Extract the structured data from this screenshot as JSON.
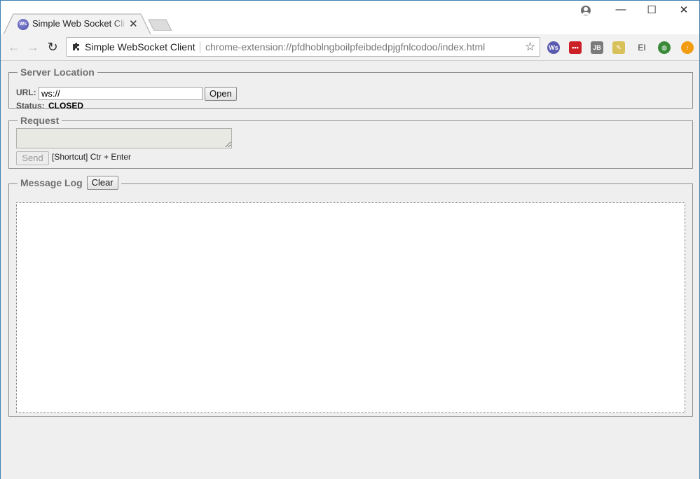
{
  "browser": {
    "tab": {
      "title": "Simple Web Socket Client",
      "favicon_text": "Ws"
    },
    "window_controls": {
      "minimize": "—",
      "maximize": "☐",
      "close": "✕"
    },
    "omnibox": {
      "page_title": "Simple WebSocket Client",
      "url": "chrome-extension://pfdhoblngboilpfeibdedpjgfnlcodoo/index.html"
    },
    "extensions": [
      {
        "name": "ws-extension-icon",
        "label": "Ws",
        "color": "#5a5ab0"
      },
      {
        "name": "lastpass-extension-icon",
        "label": "•••",
        "color": "#cc2027"
      },
      {
        "name": "jetbrains-extension-icon",
        "label": "JB",
        "color": "#7a7a7a"
      },
      {
        "name": "notes-extension-icon",
        "label": "✎",
        "color": "#d9c15a"
      },
      {
        "name": "text-cursor-extension-icon",
        "label": "EI",
        "color": "#333333"
      },
      {
        "name": "globe-extension-icon",
        "label": "◍",
        "color": "#3a8a3a"
      },
      {
        "name": "orange-up-extension-icon",
        "label": "↑",
        "color": "#f29c11"
      }
    ]
  },
  "server_location": {
    "legend": "Server Location",
    "url_label": "URL:",
    "url_value": "ws://",
    "open_label": "Open",
    "status_label": "Status:",
    "status_value": "CLOSED"
  },
  "request": {
    "legend": "Request",
    "send_label": "Send",
    "shortcut_text": "[Shortcut] Ctr + Enter"
  },
  "message_log": {
    "legend": "Message Log",
    "clear_label": "Clear"
  }
}
